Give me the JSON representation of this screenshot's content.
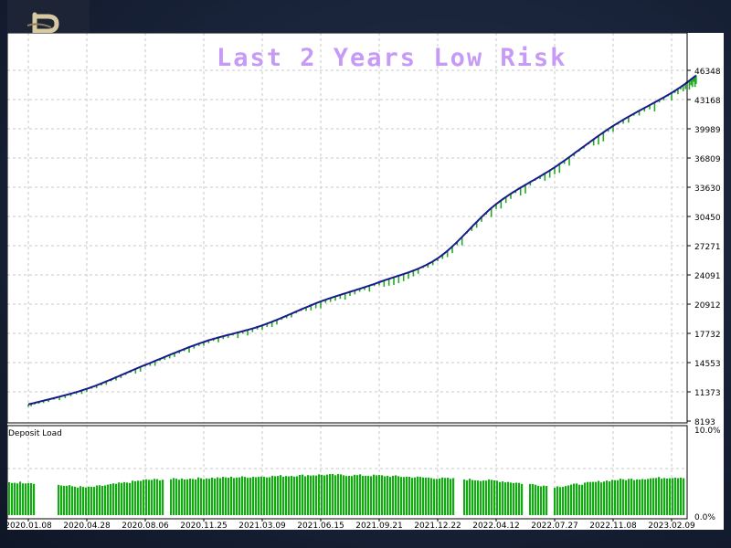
{
  "chart_data": [
    {
      "type": "line",
      "title": "Last 2 Years Low Risk",
      "y_ticks": [
        "46348",
        "43168",
        "39989",
        "36809",
        "33630",
        "30450",
        "27271",
        "24091",
        "20912",
        "17732",
        "14553",
        "11373",
        "8193"
      ],
      "ylim": [
        8193,
        46348
      ],
      "x_ticks": [
        "2020.01.08",
        "2020.04.28",
        "2020.08.06",
        "2020.11.25",
        "2021.03.09",
        "2021.06.15",
        "2021.09.21",
        "2021.12.22",
        "2022.04.12",
        "2022.07.27",
        "2022.11.08",
        "2023.02.09"
      ],
      "grid": true,
      "series": [
        {
          "color": "#1a1a8c",
          "x": [
            "2020.01.08",
            "2020.04.28",
            "2020.08.06",
            "2020.11.25",
            "2021.03.09",
            "2021.06.15",
            "2021.09.21",
            "2021.12.22",
            "2022.04.12",
            "2022.07.27",
            "2022.11.08",
            "2023.02.09",
            "2023.03.20"
          ],
          "values": [
            10000,
            11700,
            14300,
            16800,
            18600,
            21200,
            23300,
            25900,
            31800,
            35800,
            40300,
            43900,
            45800
          ]
        }
      ],
      "drawdown_color": "#1faa1f"
    },
    {
      "type": "bar",
      "title": "Deposit Load",
      "y_ticks": [
        "10.0%",
        "0.0%"
      ],
      "ylim": [
        0,
        10
      ],
      "x_ticks": [
        "2020.01.08",
        "2020.04.28",
        "2020.08.06",
        "2020.11.25",
        "2021.03.09",
        "2021.06.15",
        "2021.09.21",
        "2021.12.22",
        "2022.04.12",
        "2022.07.27",
        "2022.11.08",
        "2023.02.09"
      ],
      "color": "#11aa11",
      "categories": [
        "2020.01",
        "2020.04",
        "2020.08",
        "2020.11",
        "2021.03",
        "2021.06",
        "2021.09",
        "2021.12",
        "2022.04",
        "2022.07",
        "2022.11",
        "2023.02"
      ],
      "values": [
        3.8,
        3.2,
        4.1,
        4.3,
        4.5,
        4.7,
        4.6,
        4.3,
        4.0,
        3.3,
        4.1,
        4.4
      ]
    }
  ]
}
